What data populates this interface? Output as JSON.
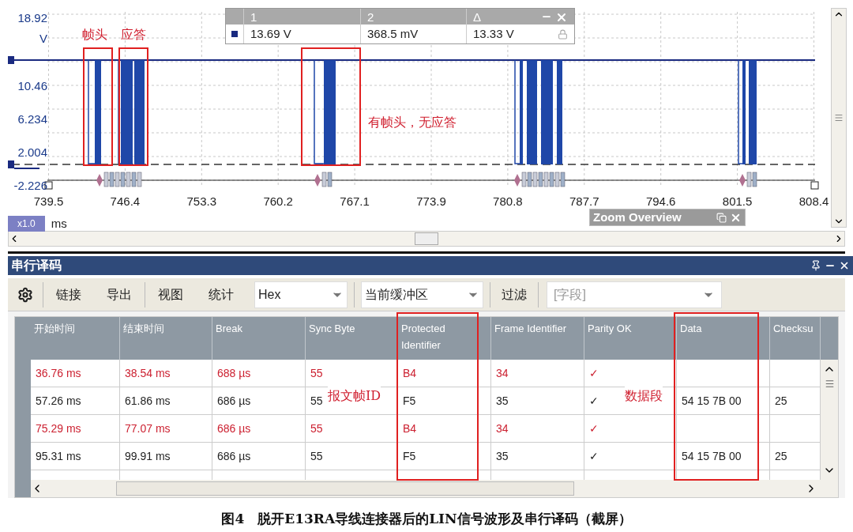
{
  "chart": {
    "y_ticks": [
      "18.92",
      "V",
      "10.46",
      "6.234",
      "2.004",
      "-2.226"
    ],
    "x_ticks": [
      "739.5",
      "746.4",
      "753.3",
      "760.2",
      "767.1",
      "773.9",
      "780.8",
      "787.7",
      "794.6",
      "801.5",
      "808.4"
    ],
    "zoom_factor": "x1.0",
    "unit": "ms",
    "annotations": [
      "帧头",
      "应答",
      "有帧头，无应答"
    ],
    "measurements": {
      "columns": [
        "1",
        "2",
        "Δ"
      ],
      "values": [
        "13.69 V",
        "368.5 mV",
        "13.33 V"
      ]
    },
    "zoom_overview": {
      "title": "Zoom Overview"
    }
  },
  "panel": {
    "title": "串行译码"
  },
  "toolbar": {
    "buttons": [
      "链接",
      "导出",
      "视图",
      "统计"
    ],
    "format": "Hex",
    "buffer": "当前缓冲区",
    "filter": "过滤",
    "field": {
      "placeholder": "[字段]"
    }
  },
  "table": {
    "columns": [
      "开始时间",
      "结束时间",
      "Break",
      "Sync Byte",
      "Protected Identifier",
      "Frame Identifier",
      "Parity OK",
      "Data",
      "Checksu"
    ],
    "rows": [
      {
        "kind": "header_only",
        "cells": [
          "36.76 ms",
          "38.54 ms",
          "688 µs",
          "55",
          "B4",
          "34",
          "✓",
          "",
          ""
        ]
      },
      {
        "kind": "full",
        "cells": [
          "57.26 ms",
          "61.86 ms",
          "686 µs",
          "55",
          "F5",
          "35",
          "✓",
          "54 15 7B 00",
          "25"
        ]
      },
      {
        "kind": "header_only",
        "cells": [
          "75.29 ms",
          "77.07 ms",
          "686 µs",
          "55",
          "B4",
          "34",
          "✓",
          "",
          ""
        ]
      },
      {
        "kind": "full",
        "cells": [
          "95.31 ms",
          "99.91 ms",
          "686 µs",
          "55",
          "F5",
          "35",
          "✓",
          "54 15 7B 00",
          "25"
        ]
      }
    ],
    "annotations": [
      "报文帧ID",
      "数据段"
    ]
  },
  "caption": "图4　脱开E13RA导线连接器后的LIN信号波形及串行译码（截屏）"
}
